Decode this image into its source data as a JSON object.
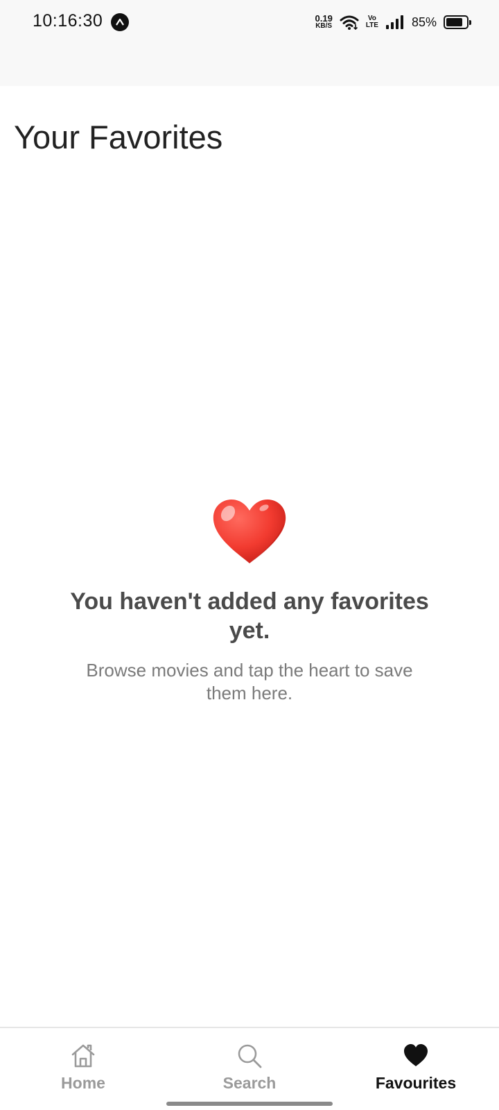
{
  "status_bar": {
    "time": "10:16:30",
    "net_speed_value": "0.19",
    "net_speed_unit": "KB/S",
    "volte_top": "Vo",
    "volte_bottom": "LTE",
    "battery_percent_label": "85%",
    "battery_level": 0.85,
    "icons": [
      "app-notification-icon",
      "wifi-icon",
      "signal-icon",
      "battery-icon"
    ]
  },
  "header": {
    "title": "Your Favorites"
  },
  "empty_state": {
    "icon": "heart-icon",
    "icon_color": "#e53935",
    "title": "You haven't added any favorites yet.",
    "subtitle": "Browse movies and tap the heart to save them here."
  },
  "bottom_nav": {
    "items": [
      {
        "label": "Home",
        "icon": "home-icon",
        "active": false
      },
      {
        "label": "Search",
        "icon": "search-icon",
        "active": false
      },
      {
        "label": "Favourites",
        "icon": "heart-icon",
        "active": true
      }
    ],
    "active_color": "#111111",
    "inactive_color": "#9a9a9a"
  }
}
